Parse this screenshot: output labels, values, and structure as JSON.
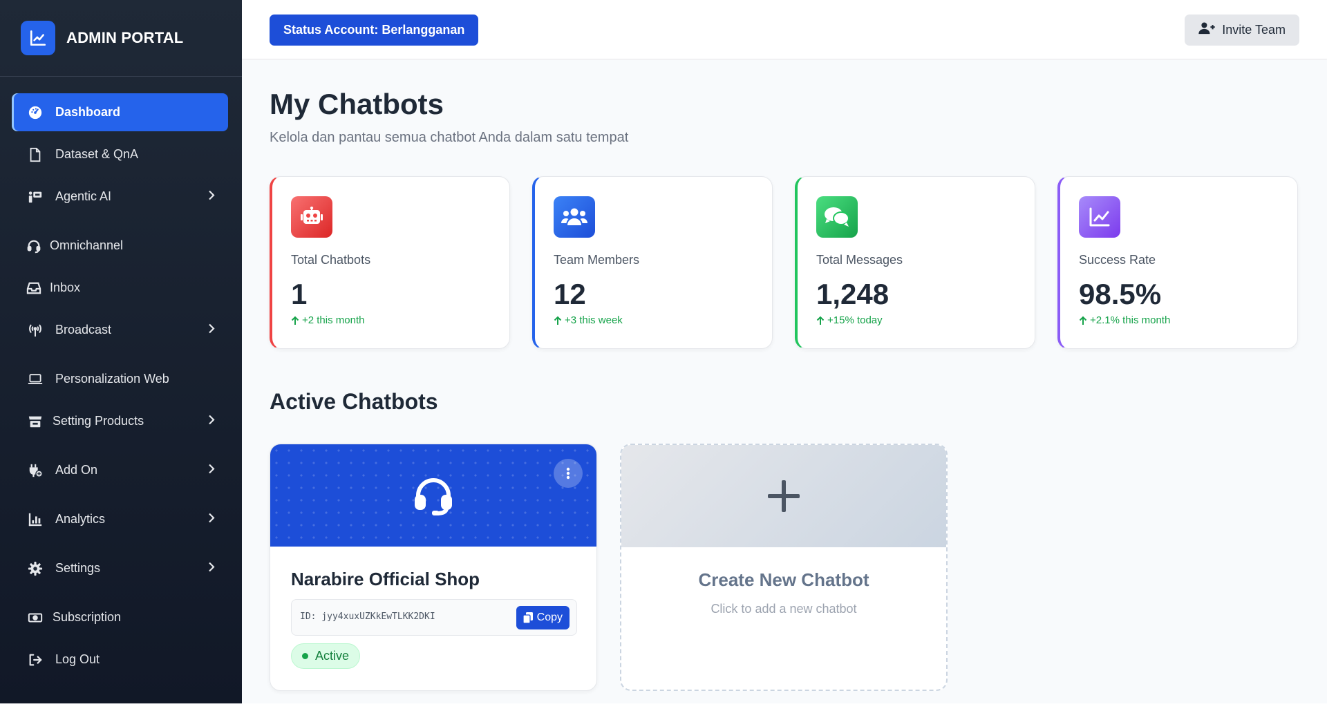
{
  "brand": {
    "title": "ADMIN PORTAL"
  },
  "sidebar": {
    "items": [
      {
        "label": "Dashboard",
        "icon": "dashboard-icon",
        "active": true,
        "has_chevron": false
      },
      {
        "label": "Dataset & QnA",
        "icon": "file-icon",
        "has_chevron": false
      },
      {
        "label": "Agentic AI",
        "icon": "agent-icon",
        "has_chevron": true
      },
      {
        "label": "Omnichannel",
        "icon": "headset-icon",
        "has_chevron": false
      },
      {
        "label": "Inbox",
        "icon": "inbox-icon",
        "has_chevron": false
      },
      {
        "label": "Broadcast",
        "icon": "broadcast-icon",
        "has_chevron": true
      },
      {
        "label": "Personalization Web",
        "icon": "laptop-icon",
        "has_chevron": false
      },
      {
        "label": "Setting Products",
        "icon": "store-icon",
        "has_chevron": true
      },
      {
        "label": "Add On",
        "icon": "plugin-icon",
        "has_chevron": true
      },
      {
        "label": "Analytics",
        "icon": "analytics-icon",
        "has_chevron": true
      },
      {
        "label": "Settings",
        "icon": "gear-icon",
        "has_chevron": true
      },
      {
        "label": "Subscription",
        "icon": "money-icon",
        "has_chevron": false
      },
      {
        "label": "Log Out",
        "icon": "logout-icon",
        "has_chevron": false
      }
    ]
  },
  "topbar": {
    "status_label": "Status Account: Berlangganan",
    "invite_label": "Invite Team"
  },
  "main": {
    "title": "My Chatbots",
    "subtitle": "Kelola dan pantau semua chatbot Anda dalam satu tempat",
    "stats": [
      {
        "label": "Total Chatbots",
        "value": "1",
        "trend": "+2 this month",
        "icon": "robot-icon",
        "accent": "#ef4444"
      },
      {
        "label": "Team Members",
        "value": "12",
        "trend": "+3 this week",
        "icon": "users-icon",
        "accent": "#2563eb"
      },
      {
        "label": "Total Messages",
        "value": "1,248",
        "trend": "+15% today",
        "icon": "chat-icon",
        "accent": "#22c55e"
      },
      {
        "label": "Success Rate",
        "value": "98.5%",
        "trend": "+2.1% this month",
        "icon": "chart-line-icon",
        "accent": "#8b5cf6"
      }
    ],
    "section_title": "Active Chatbots",
    "chatbot": {
      "name": "Narabire Official Shop",
      "id_text": "ID: jyy4xuxUZKkEwTLKK2DKI",
      "copy_label": "Copy",
      "status": "Active"
    },
    "new_chatbot": {
      "title": "Create New Chatbot",
      "subtitle": "Click to add a new chatbot"
    }
  },
  "colors": {
    "primary": "#1d4ed8",
    "sidebar_bg": "#1f2937",
    "success": "#16a34a"
  }
}
